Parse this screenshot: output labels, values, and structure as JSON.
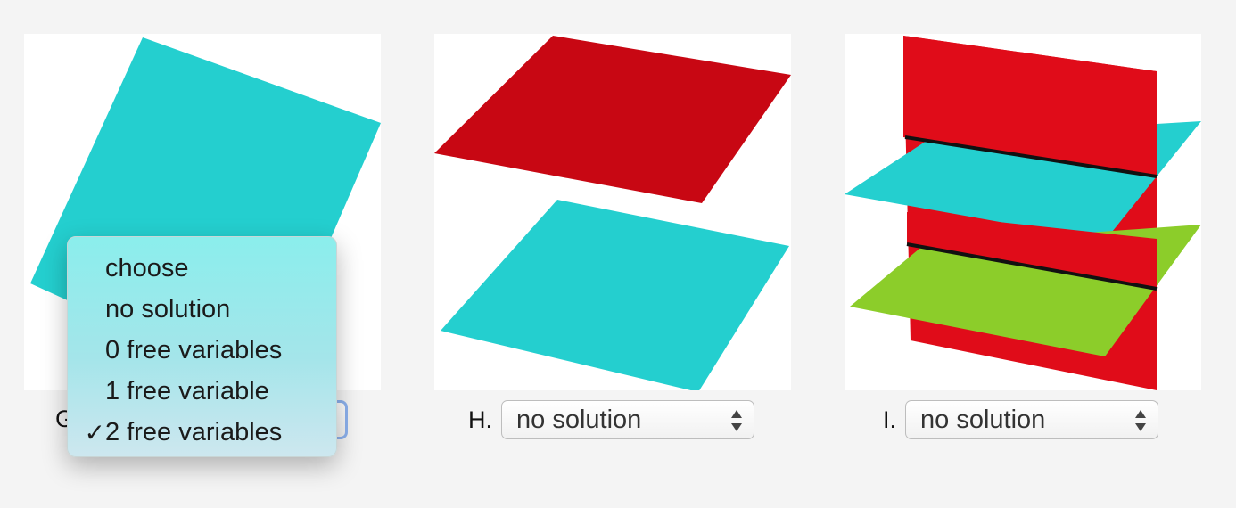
{
  "panels": [
    {
      "id": "G",
      "label": "G.",
      "selected": "2 free variables"
    },
    {
      "id": "H",
      "label": "H.",
      "selected": "no solution"
    },
    {
      "id": "I",
      "label": "I.",
      "selected": "no solution"
    }
  ],
  "dropdown": {
    "options": [
      "choose",
      "no solution",
      "0 free variables",
      "1 free variable",
      "2 free variables"
    ],
    "checked_index": 4,
    "check_mark": "✓"
  },
  "colors": {
    "cyan": "#24cfcf",
    "red": "#d10d17",
    "green": "#8ccd2a"
  },
  "icons": {
    "select_arrows": "up-down-arrows-icon",
    "check": "checkmark-icon"
  }
}
